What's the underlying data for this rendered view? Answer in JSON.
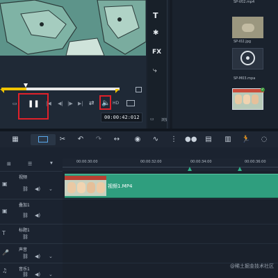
{
  "player": {
    "timecode": "00:00:42:012",
    "controls": [
      "pause",
      "previous-frame-start",
      "prev",
      "next",
      "end",
      "repeat",
      "volume",
      "aspect",
      "resolution"
    ]
  },
  "side_tools": [
    "T",
    "FX"
  ],
  "library": {
    "items": [
      {
        "label": "SP-V02.mp4"
      },
      {
        "label": "SP-I02.jpg"
      },
      {
        "label": "SP-M03.mpa"
      },
      {
        "label": ""
      }
    ],
    "browse_label": "浏览"
  },
  "timeline": {
    "ruler_labels": [
      "00:00:30:00",
      "00:00:32:00",
      "00:00:34:00",
      "00:00:36:00"
    ],
    "tracks": [
      {
        "name": "视频"
      },
      {
        "name": "叠加1"
      },
      {
        "name": "标题1"
      },
      {
        "name": "声音"
      },
      {
        "name": "音乐1"
      }
    ],
    "clip_label": "视频1.MP4"
  },
  "watermark": "@稀土掘金技术社区",
  "colors": {
    "clip": "#2f9e7e",
    "highlight_box": "#e0212a",
    "playhead": "#f0c400",
    "accent_blue": "#3a8ad6"
  }
}
